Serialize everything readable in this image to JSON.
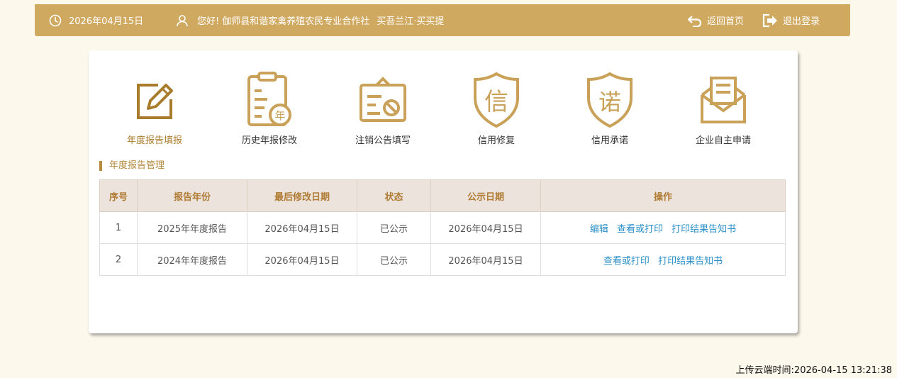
{
  "header": {
    "date": "2026年04月15日",
    "greeting": "您好!",
    "company": "伽师县和谐家禽养殖农民专业合作社",
    "person": "买吾兰江·买买提",
    "home_label": "返回首页",
    "logout_label": "退出登录"
  },
  "menu": [
    {
      "label": "年度报告填报",
      "icon": "edit-pencil-icon"
    },
    {
      "label": "历史年报修改",
      "icon": "clipboard-year-icon"
    },
    {
      "label": "注销公告填写",
      "icon": "cancel-notice-icon"
    },
    {
      "label": "信用修复",
      "icon": "shield-credit-icon"
    },
    {
      "label": "信用承诺",
      "icon": "shield-promise-icon"
    },
    {
      "label": "企业自主申请",
      "icon": "envelope-icon"
    }
  ],
  "section_title": "年度报告管理",
  "table": {
    "headers": [
      "序号",
      "报告年份",
      "最后修改日期",
      "状态",
      "公示日期",
      "操作"
    ],
    "rows": [
      {
        "index": "1",
        "year": "2025年年度报告",
        "modified": "2026年04月15日",
        "status": "已公示",
        "publish": "2026年04月15日",
        "actions": [
          "编辑",
          "查看或打印",
          "打印结果告知书"
        ]
      },
      {
        "index": "2",
        "year": "2024年年度报告",
        "modified": "2026年04月15日",
        "status": "已公示",
        "publish": "2026年04月15日",
        "actions": [
          "查看或打印",
          "打印结果告知书"
        ]
      }
    ]
  },
  "footer": {
    "upload_time": "上传云端时间:2026-04-15 13:21:38"
  },
  "colors": {
    "accent": "#d0a960",
    "icon": "#c9a158",
    "link": "#2a8fc8",
    "page_bg": "#fdf8ec"
  }
}
